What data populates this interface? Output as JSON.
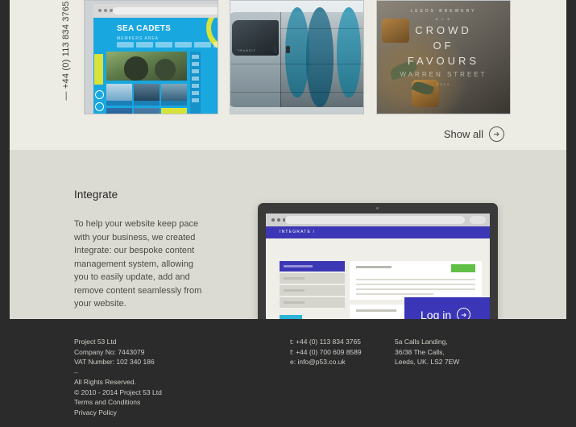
{
  "colors": {
    "band_work_bg": "#edece4",
    "band_integrate_bg": "#dcdbd3",
    "footer_bg": "#2b2b2b",
    "gutter": "#2b2b2b",
    "accent_indigo": "#3b36b8",
    "accent_cyan": "#2bb3d8",
    "accent_green": "#62bf45",
    "sea_cadets_blue": "#19a7e0",
    "sea_cadets_yellow": "#d8e23a"
  },
  "work": {
    "phone_rail": "— +44 (0) 113 834 3765",
    "cards": [
      {
        "name": "sea-cadets",
        "logo": "SEA CADETS",
        "logo_sub": "MEMBERS AREA"
      },
      {
        "name": "transit-van",
        "badge": "TRANSIT"
      },
      {
        "name": "leeds-brewery",
        "arc_top": "LEEDS BREWERY",
        "sub": "A L E",
        "line1": "CROWD",
        "line2": "OF",
        "line3": "FAVOURS",
        "street": "WARREN STREET",
        "year": "2013"
      }
    ],
    "show_all_label": "Show all"
  },
  "integrate": {
    "title": "Integrate",
    "copy": "To help your website keep pace with your business, we created Integrate: our bespoke content management system, allowing you to easily update, add and remove content seamlessly from your website.",
    "laptop": {
      "header_label": "INTEGRATE /",
      "login_label": "Log in"
    }
  },
  "footer": {
    "company": {
      "name": "Project 53 Ltd",
      "company_no": "Company No: 7443079",
      "vat": "VAT Number: 102 340 186",
      "divider": "–",
      "rights": "All Rights Reserved.",
      "copyright": "© 2010 - 2014 Project 53 Ltd",
      "terms_link": "Terms and Conditions",
      "privacy_link": "Privacy Policy"
    },
    "contact": {
      "tel": "t: +44 (0) 113 834 3765",
      "fax": "f: +44 (0) 700 609 8589",
      "email": "e: info@p53.co.uk"
    },
    "address": {
      "line1": "5a Calls Landing,",
      "line2": "36/38 The Calls,",
      "line3": "Leeds, UK. LS2 7EW"
    }
  }
}
